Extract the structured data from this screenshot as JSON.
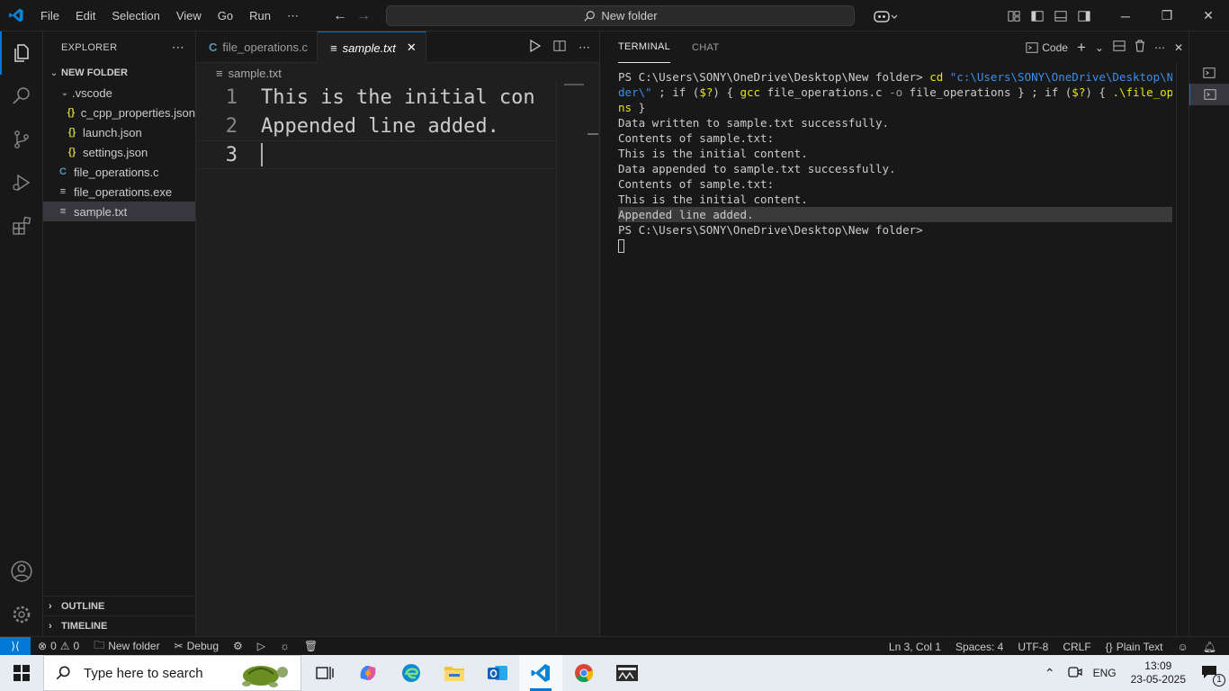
{
  "titlebar": {
    "menu": [
      "File",
      "Edit",
      "Selection",
      "View",
      "Go",
      "Run",
      "⋯"
    ],
    "search_text": "New folder"
  },
  "sidebar": {
    "header": "EXPLORER",
    "folder_name": "NEW FOLDER",
    "tree": [
      {
        "label": ".vscode",
        "icon": "folder-open-chevron",
        "indent": 1
      },
      {
        "label": "c_cpp_properties.json",
        "icon": "json-icon",
        "indent": 2
      },
      {
        "label": "launch.json",
        "icon": "json-icon",
        "indent": 2
      },
      {
        "label": "settings.json",
        "icon": "json-icon",
        "indent": 2
      },
      {
        "label": "file_operations.c",
        "icon": "c-file-icon",
        "indent": 1
      },
      {
        "label": "file_operations.exe",
        "icon": "lines-file-icon",
        "indent": 1
      },
      {
        "label": "sample.txt",
        "icon": "lines-file-icon",
        "indent": 1,
        "selected": true
      }
    ],
    "outline": "OUTLINE",
    "timeline": "TIMELINE"
  },
  "editor": {
    "tabs": [
      {
        "label": "file_operations.c",
        "icon": "C"
      },
      {
        "label": "sample.txt",
        "icon": "≡",
        "active": true
      }
    ],
    "breadcrumb": "sample.txt",
    "lines": [
      {
        "num": "1",
        "text": "This is the initial con"
      },
      {
        "num": "2",
        "text": "Appended line added."
      },
      {
        "num": "3",
        "text": ""
      }
    ]
  },
  "panel": {
    "tabs": [
      "TERMINAL",
      "CHAT"
    ],
    "profile_label": "Code",
    "terminal": {
      "prompt": "PS C:\\Users\\SONY\\OneDrive\\Desktop\\New folder>",
      "cmd_cd": "cd",
      "cmd_path1": "\"c:\\Users\\SONY\\OneDrive\\Desktop\\New fol",
      "cmd_path2": "der\\\"",
      "cmd_part2a": " ; if (",
      "cmd_var": "$?",
      "cmd_part2b": ") { ",
      "cmd_gcc": "gcc",
      "cmd_part2c": " file_operations.c ",
      "cmd_flag": "-o",
      "cmd_part2d": " file_operations } ; if (",
      "cmd_part2e": ") { ",
      "cmd_exe1": ".\\file_operatio",
      "cmd_exe2": "ns",
      "cmd_end": " }",
      "output": [
        "Data written to sample.txt successfully.",
        "Contents of sample.txt:",
        "This is the initial content.",
        "Data appended to sample.txt successfully.",
        "Contents of sample.txt:",
        "This is the initial content.",
        "Appended line added."
      ],
      "final_prompt": "PS C:\\Users\\SONY\\OneDrive\\Desktop\\New folder>"
    }
  },
  "statusbar": {
    "errors": "0",
    "warnings": "0",
    "folder": "New folder",
    "debug": "Debug",
    "position": "Ln 3, Col 1",
    "spaces": "Spaces: 4",
    "encoding": "UTF-8",
    "eol": "CRLF",
    "language": "Plain Text"
  },
  "taskbar": {
    "search_placeholder": "Type here to search",
    "lang": "ENG",
    "time": "13:09",
    "date": "23-05-2025",
    "notif_count": "1"
  }
}
